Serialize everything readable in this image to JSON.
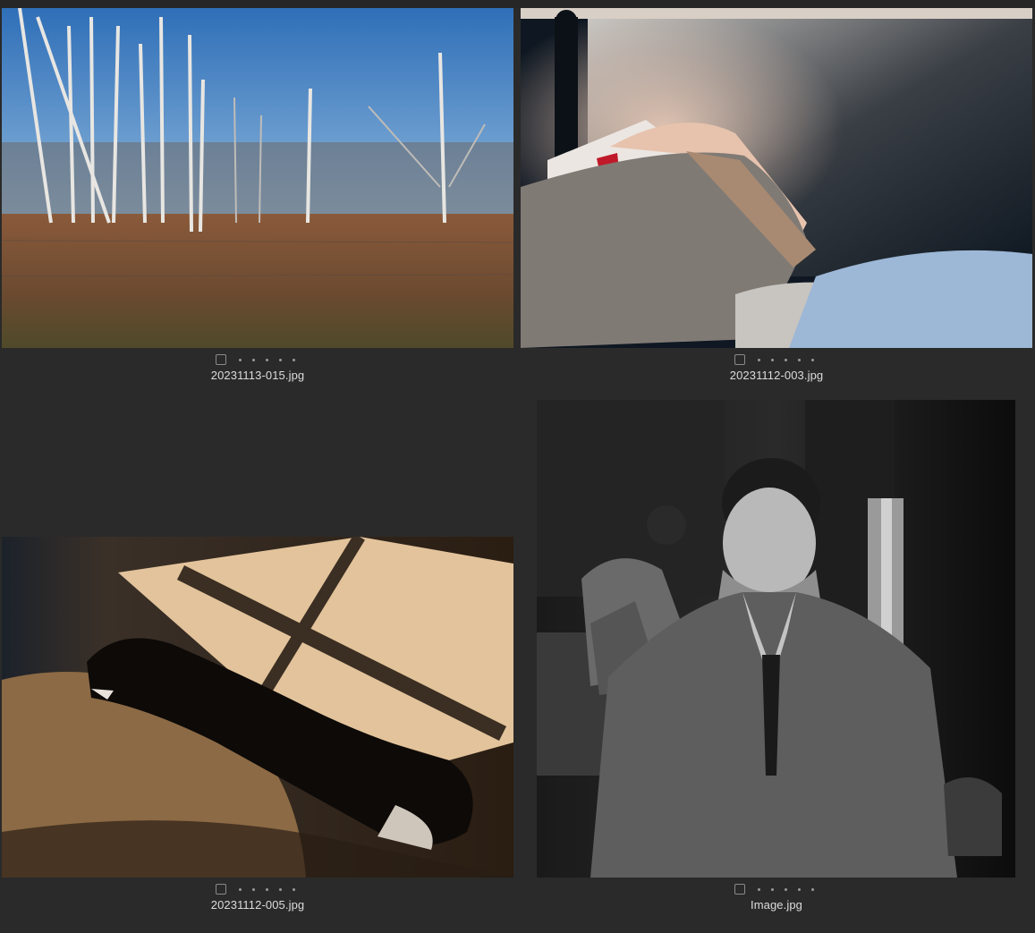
{
  "thumbnails": [
    {
      "filename": "20231113-015.jpg",
      "checked": false,
      "rating": 0,
      "subject": "birch trees and dry meadow under blue sky"
    },
    {
      "filename": "20231112-003.jpg",
      "checked": false,
      "rating": 0,
      "subject": "person under grey blanket on bed"
    },
    {
      "filename": "20231112-005.jpg",
      "checked": false,
      "rating": 0,
      "subject": "black dog sleeping in window light"
    },
    {
      "filename": "Image.jpg",
      "checked": false,
      "rating": 0,
      "subject": "black and white portrait of man in cardigan"
    }
  ],
  "colors": {
    "background": "#2a2a2a",
    "filename_text": "#dcdcdc",
    "dot": "#9a9a9a"
  }
}
